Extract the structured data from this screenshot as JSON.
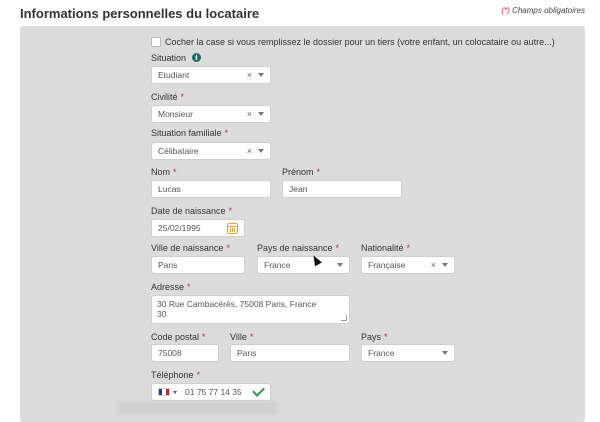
{
  "header": {
    "title": "Informations personnelles du locataire",
    "mandatory_star": "(*)",
    "mandatory_text": "Champs obligatoires"
  },
  "form": {
    "third_party_checkbox_label": "Cocher la case si vous remplissez le dossier pour un tiers (votre enfant, un colocataire ou autre...)",
    "situation": {
      "label": "Situation",
      "value": "Etudiant"
    },
    "civilite": {
      "label": "Civilité",
      "value": "Monsieur"
    },
    "situation_familiale": {
      "label": "Situation familiale",
      "value": "Célibataire"
    },
    "nom": {
      "label": "Nom",
      "value": "Lucas"
    },
    "prenom": {
      "label": "Prénom",
      "value": "Jean"
    },
    "date_naissance": {
      "label": "Date de naissance",
      "value": "25/02/1995"
    },
    "ville_naissance": {
      "label": "Ville de naissance",
      "value": "Paris"
    },
    "pays_naissance": {
      "label": "Pays de naissance",
      "value": "France"
    },
    "nationalite": {
      "label": "Nationalité",
      "value": "Française"
    },
    "adresse": {
      "label": "Adresse",
      "line1": "30 Rue Cambacérès, 75008 Paris, France",
      "line2": "30"
    },
    "code_postal": {
      "label": "Code postal",
      "value": "75008"
    },
    "ville": {
      "label": "Ville",
      "value": "Paris"
    },
    "pays": {
      "label": "Pays",
      "value": "France"
    },
    "telephone": {
      "label": "Téléphone",
      "value": "01 75 77 14 35"
    }
  },
  "icons": {
    "info": "i",
    "clear": "×"
  },
  "colors": {
    "required_star": "#d0242b",
    "info_icon": "#1f6b6a",
    "calendar_icon": "#e8a23a",
    "valid_check": "#2e9a4a",
    "panel_bg": "#dcdcdc"
  }
}
